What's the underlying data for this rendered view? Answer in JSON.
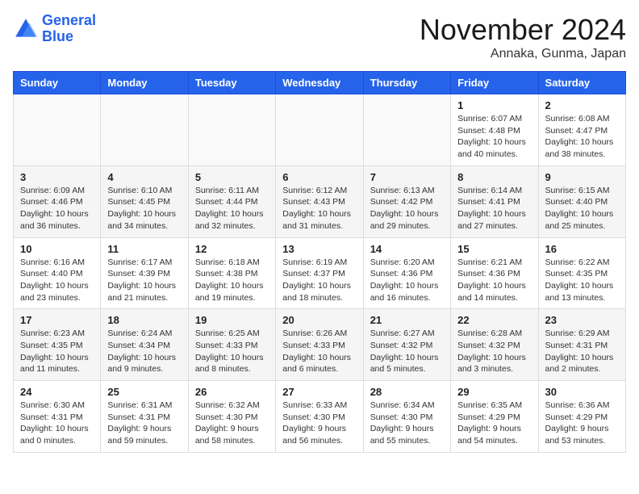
{
  "logo": {
    "line1": "General",
    "line2": "Blue"
  },
  "title": "November 2024",
  "location": "Annaka, Gunma, Japan",
  "weekdays": [
    "Sunday",
    "Monday",
    "Tuesday",
    "Wednesday",
    "Thursday",
    "Friday",
    "Saturday"
  ],
  "weeks": [
    [
      {
        "day": "",
        "info": ""
      },
      {
        "day": "",
        "info": ""
      },
      {
        "day": "",
        "info": ""
      },
      {
        "day": "",
        "info": ""
      },
      {
        "day": "",
        "info": ""
      },
      {
        "day": "1",
        "info": "Sunrise: 6:07 AM\nSunset: 4:48 PM\nDaylight: 10 hours\nand 40 minutes."
      },
      {
        "day": "2",
        "info": "Sunrise: 6:08 AM\nSunset: 4:47 PM\nDaylight: 10 hours\nand 38 minutes."
      }
    ],
    [
      {
        "day": "3",
        "info": "Sunrise: 6:09 AM\nSunset: 4:46 PM\nDaylight: 10 hours\nand 36 minutes."
      },
      {
        "day": "4",
        "info": "Sunrise: 6:10 AM\nSunset: 4:45 PM\nDaylight: 10 hours\nand 34 minutes."
      },
      {
        "day": "5",
        "info": "Sunrise: 6:11 AM\nSunset: 4:44 PM\nDaylight: 10 hours\nand 32 minutes."
      },
      {
        "day": "6",
        "info": "Sunrise: 6:12 AM\nSunset: 4:43 PM\nDaylight: 10 hours\nand 31 minutes."
      },
      {
        "day": "7",
        "info": "Sunrise: 6:13 AM\nSunset: 4:42 PM\nDaylight: 10 hours\nand 29 minutes."
      },
      {
        "day": "8",
        "info": "Sunrise: 6:14 AM\nSunset: 4:41 PM\nDaylight: 10 hours\nand 27 minutes."
      },
      {
        "day": "9",
        "info": "Sunrise: 6:15 AM\nSunset: 4:40 PM\nDaylight: 10 hours\nand 25 minutes."
      }
    ],
    [
      {
        "day": "10",
        "info": "Sunrise: 6:16 AM\nSunset: 4:40 PM\nDaylight: 10 hours\nand 23 minutes."
      },
      {
        "day": "11",
        "info": "Sunrise: 6:17 AM\nSunset: 4:39 PM\nDaylight: 10 hours\nand 21 minutes."
      },
      {
        "day": "12",
        "info": "Sunrise: 6:18 AM\nSunset: 4:38 PM\nDaylight: 10 hours\nand 19 minutes."
      },
      {
        "day": "13",
        "info": "Sunrise: 6:19 AM\nSunset: 4:37 PM\nDaylight: 10 hours\nand 18 minutes."
      },
      {
        "day": "14",
        "info": "Sunrise: 6:20 AM\nSunset: 4:36 PM\nDaylight: 10 hours\nand 16 minutes."
      },
      {
        "day": "15",
        "info": "Sunrise: 6:21 AM\nSunset: 4:36 PM\nDaylight: 10 hours\nand 14 minutes."
      },
      {
        "day": "16",
        "info": "Sunrise: 6:22 AM\nSunset: 4:35 PM\nDaylight: 10 hours\nand 13 minutes."
      }
    ],
    [
      {
        "day": "17",
        "info": "Sunrise: 6:23 AM\nSunset: 4:35 PM\nDaylight: 10 hours\nand 11 minutes."
      },
      {
        "day": "18",
        "info": "Sunrise: 6:24 AM\nSunset: 4:34 PM\nDaylight: 10 hours\nand 9 minutes."
      },
      {
        "day": "19",
        "info": "Sunrise: 6:25 AM\nSunset: 4:33 PM\nDaylight: 10 hours\nand 8 minutes."
      },
      {
        "day": "20",
        "info": "Sunrise: 6:26 AM\nSunset: 4:33 PM\nDaylight: 10 hours\nand 6 minutes."
      },
      {
        "day": "21",
        "info": "Sunrise: 6:27 AM\nSunset: 4:32 PM\nDaylight: 10 hours\nand 5 minutes."
      },
      {
        "day": "22",
        "info": "Sunrise: 6:28 AM\nSunset: 4:32 PM\nDaylight: 10 hours\nand 3 minutes."
      },
      {
        "day": "23",
        "info": "Sunrise: 6:29 AM\nSunset: 4:31 PM\nDaylight: 10 hours\nand 2 minutes."
      }
    ],
    [
      {
        "day": "24",
        "info": "Sunrise: 6:30 AM\nSunset: 4:31 PM\nDaylight: 10 hours\nand 0 minutes."
      },
      {
        "day": "25",
        "info": "Sunrise: 6:31 AM\nSunset: 4:31 PM\nDaylight: 9 hours\nand 59 minutes."
      },
      {
        "day": "26",
        "info": "Sunrise: 6:32 AM\nSunset: 4:30 PM\nDaylight: 9 hours\nand 58 minutes."
      },
      {
        "day": "27",
        "info": "Sunrise: 6:33 AM\nSunset: 4:30 PM\nDaylight: 9 hours\nand 56 minutes."
      },
      {
        "day": "28",
        "info": "Sunrise: 6:34 AM\nSunset: 4:30 PM\nDaylight: 9 hours\nand 55 minutes."
      },
      {
        "day": "29",
        "info": "Sunrise: 6:35 AM\nSunset: 4:29 PM\nDaylight: 9 hours\nand 54 minutes."
      },
      {
        "day": "30",
        "info": "Sunrise: 6:36 AM\nSunset: 4:29 PM\nDaylight: 9 hours\nand 53 minutes."
      }
    ]
  ]
}
